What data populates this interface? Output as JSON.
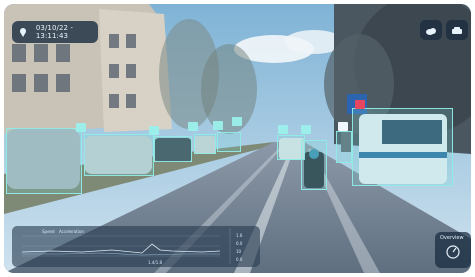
{
  "overlay": {
    "timestamp": "03/10/22 - 13:11:43",
    "corner_widget_label": "Overview"
  },
  "telemetry": {
    "series_labels": [
      "Speed",
      "Acceleration"
    ],
    "x_tick_label": "1.4/1.8",
    "right_values": [
      "1.6",
      "0.0",
      "10",
      "0.0"
    ]
  },
  "icons": [
    "map-pin-icon",
    "cloud-icon",
    "car-icon",
    "compass-icon"
  ],
  "colors": {
    "detection_box": "#91ebe6",
    "panel_bg": "#28425a",
    "tag_red": "#f0465a"
  }
}
